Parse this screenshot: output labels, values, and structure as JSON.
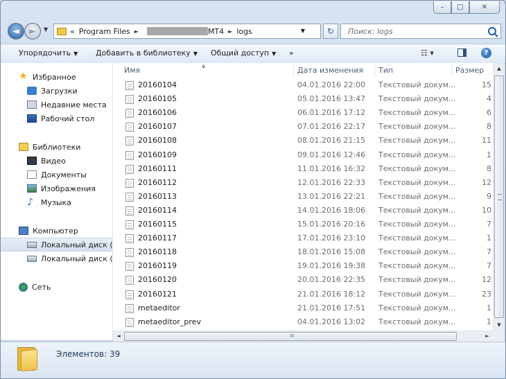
{
  "window": {
    "minimize": "–",
    "maximize": "□",
    "close": "✕"
  },
  "address": {
    "back": "◄",
    "forward": "►",
    "overflow": "«",
    "crumb1": "Program Files",
    "crumb2": "MT4",
    "crumb3": "logs",
    "sep": "►",
    "dropdown": "▼",
    "refresh": "↻"
  },
  "search": {
    "placeholder": "Поиск: logs"
  },
  "toolbar": {
    "organize": "Упорядочить",
    "library": "Добавить в библиотеку",
    "share": "Общий доступ",
    "more": "»",
    "arrow": "▼",
    "views": "☷ ▾",
    "help": "?"
  },
  "nav": {
    "favorites": "Избранное",
    "downloads": "Загрузки",
    "recent": "Недавние места",
    "desktop": "Рабочий стол",
    "libraries": "Библиотеки",
    "video": "Видео",
    "documents": "Документы",
    "images": "Изображения",
    "music": "Музыка",
    "computer": "Компьютер",
    "diskC": "Локальный диск (C",
    "diskD": "Локальный диск (D",
    "network": "Сеть"
  },
  "columns": {
    "name": "Имя",
    "date": "Дата изменения",
    "type": "Тип",
    "size": "Размер",
    "sort": "▲"
  },
  "files": [
    {
      "name": "20160104",
      "date": "04.01.2016 22:00",
      "type": "Текстовый докум...",
      "size": "15"
    },
    {
      "name": "20160105",
      "date": "05.01.2016 13:47",
      "type": "Текстовый докум...",
      "size": "4"
    },
    {
      "name": "20160106",
      "date": "06.01.2016 17:12",
      "type": "Текстовый докум...",
      "size": "6"
    },
    {
      "name": "20160107",
      "date": "07.01.2016 22:17",
      "type": "Текстовый докум...",
      "size": "8"
    },
    {
      "name": "20160108",
      "date": "08.01.2016 21:15",
      "type": "Текстовый докум...",
      "size": "11"
    },
    {
      "name": "20160109",
      "date": "09.01.2016 12:46",
      "type": "Текстовый докум...",
      "size": "1"
    },
    {
      "name": "20160111",
      "date": "11.01.2016 16:32",
      "type": "Текстовый докум...",
      "size": "8"
    },
    {
      "name": "20160112",
      "date": "12.01.2016 22:33",
      "type": "Текстовый докум...",
      "size": "12"
    },
    {
      "name": "20160113",
      "date": "13.01.2016 22:21",
      "type": "Текстовый докум...",
      "size": "9"
    },
    {
      "name": "20160114",
      "date": "14.01.2016 18:06",
      "type": "Текстовый докум...",
      "size": "10"
    },
    {
      "name": "20160115",
      "date": "15.01.2016 20:16",
      "type": "Текстовый докум...",
      "size": "7"
    },
    {
      "name": "20160117",
      "date": "17.01.2016 23:10",
      "type": "Текстовый докум...",
      "size": "1"
    },
    {
      "name": "20160118",
      "date": "18.01.2016 15:08",
      "type": "Текстовый докум...",
      "size": "7"
    },
    {
      "name": "20160119",
      "date": "19.01.2016 19:38",
      "type": "Текстовый докум...",
      "size": "7"
    },
    {
      "name": "20160120",
      "date": "20.01.2016 22:35",
      "type": "Текстовый докум...",
      "size": "12"
    },
    {
      "name": "20160121",
      "date": "21.01.2016 18:12",
      "type": "Текстовый докум...",
      "size": "23"
    },
    {
      "name": "metaeditor",
      "date": "21.01.2016 17:51",
      "type": "Текстовый докум...",
      "size": "1"
    },
    {
      "name": "metaeditor_prev",
      "date": "04.01.2016 13:02",
      "type": "Текстовый докум...",
      "size": "1"
    }
  ],
  "scroll": {
    "up": "▲",
    "down": "▼",
    "left": "◄",
    "right": "►",
    "grip": "III"
  },
  "details": {
    "count": "Элементов: 39"
  }
}
